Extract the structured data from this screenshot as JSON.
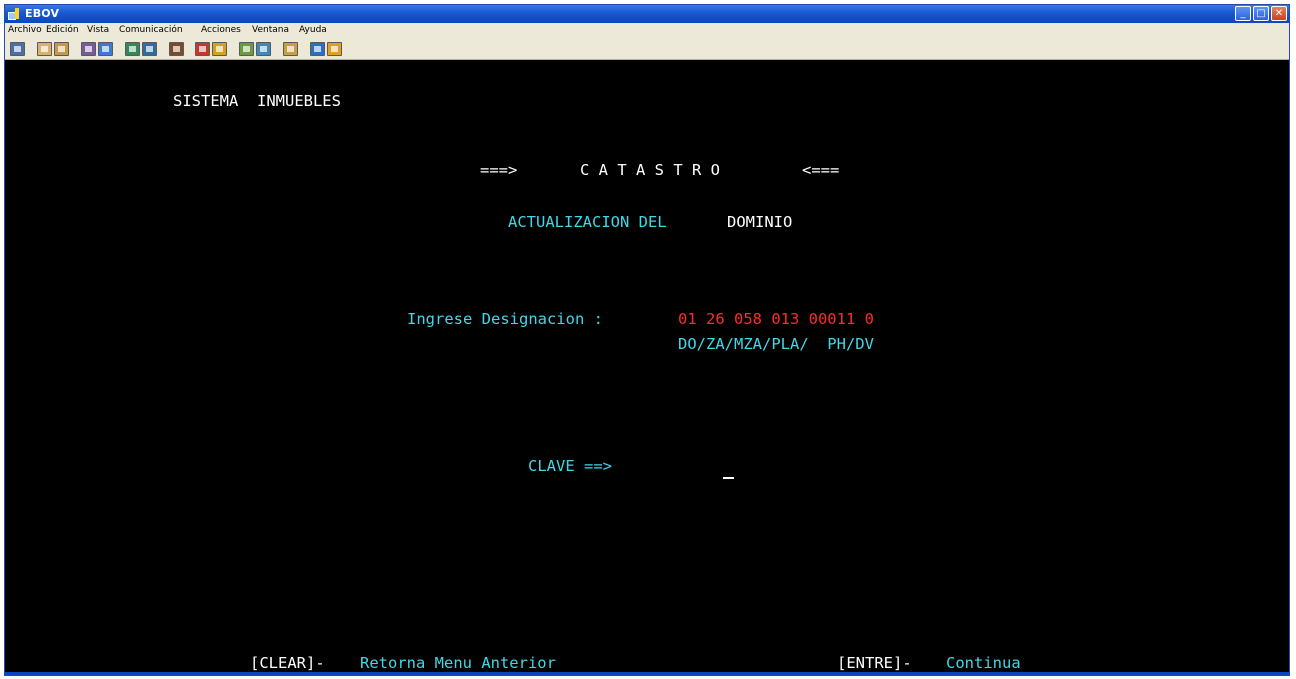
{
  "window": {
    "title": "EBOV",
    "min": "_",
    "max": "□",
    "close": "✕"
  },
  "menu": [
    "Archivo",
    "Edición",
    "Vista",
    "Comunicación",
    "Acciones",
    "Ventana",
    "Ayuda"
  ],
  "toolbar_icons": [
    "print-screen-icon",
    "copy-icon",
    "paste-icon",
    "transfer-icon",
    "transfer-alt-icon",
    "display-icon",
    "display-alt-icon",
    "macro-icon",
    "record-icon",
    "playback-icon",
    "connect-icon",
    "disconnect-icon",
    "clipboard-icon",
    "globe-icon",
    "pencil-icon"
  ],
  "toolbar_colors": [
    "#4a6fa5",
    "#d8b26a",
    "#c49a4a",
    "#7a5a9a",
    "#3a7bd5",
    "#2e8b57",
    "#2c6e9e",
    "#7a4a2a",
    "#c03a2a",
    "#d4a020",
    "#6a9a3a",
    "#3a8ac0",
    "#c8a040",
    "#2a70c0",
    "#e0a020"
  ],
  "screen": {
    "system": "SISTEMA  INMUEBLES",
    "arrow_left": "===>",
    "catastro": "C A T A S T R O",
    "arrow_right": "<===",
    "subtitle_part1": "ACTUALIZACION DEL",
    "subtitle_part2": "DOMINIO",
    "designation_label": "Ingrese Designacion :",
    "designation_value": "01 26 058 013 00011 0",
    "designation_format": "DO/ZA/MZA/PLA/  PH/DV",
    "clave_label": "CLAVE ==>",
    "clear_key": "[CLEAR]-",
    "clear_desc": "Retorna Menu Anterior",
    "enter_key": "[ENTRE]-",
    "enter_desc": "Continua"
  }
}
